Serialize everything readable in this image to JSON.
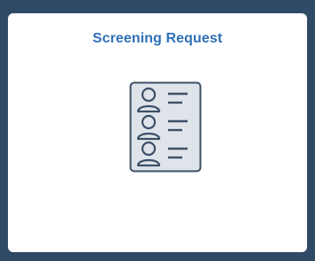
{
  "tile": {
    "title": "Screening Request",
    "icon": "person-list-document-icon",
    "colors": {
      "page_background": "#2f4a66",
      "tile_background": "#ffffff",
      "title_text": "#2f6fb7",
      "icon_stroke": "#3b4f66",
      "icon_fill": "#dfe4ea"
    }
  }
}
